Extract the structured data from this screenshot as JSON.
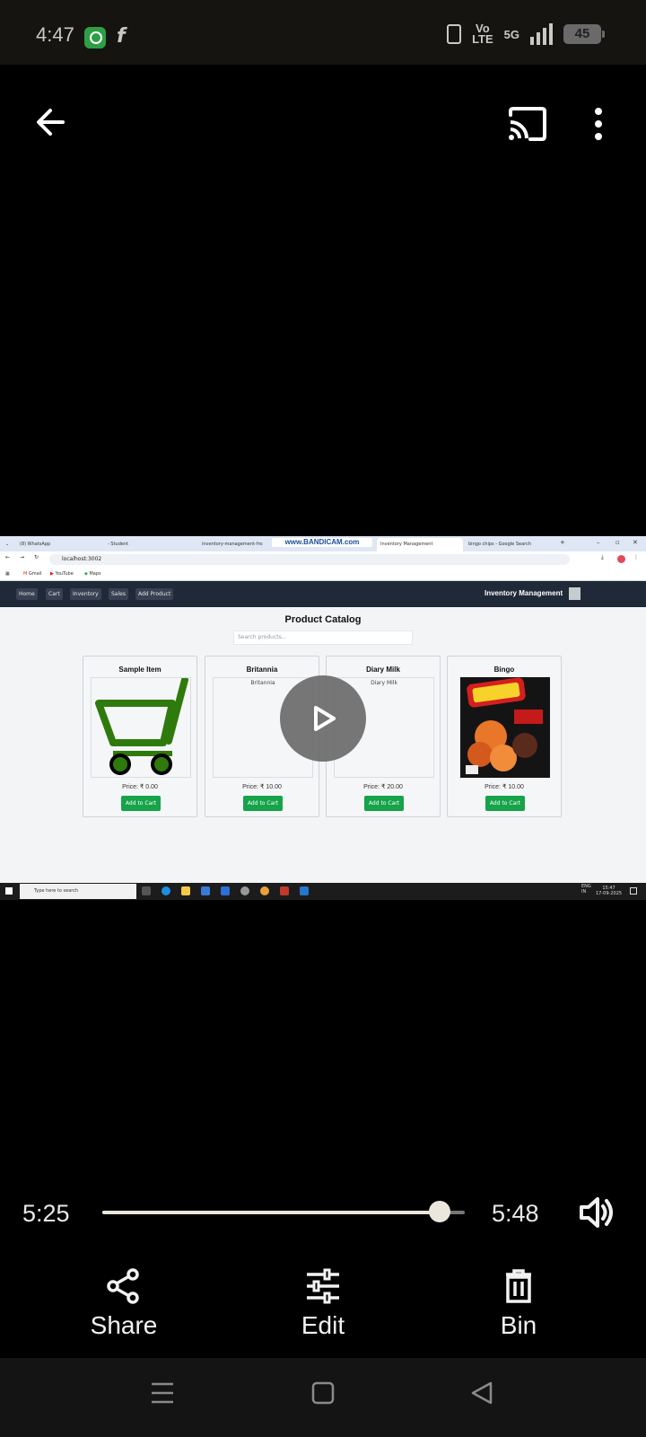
{
  "status_bar": {
    "time": "4:47",
    "network_label": "Vo\nLTE",
    "network_type": "5G",
    "battery": "45"
  },
  "browser": {
    "tabs": [
      "(8) WhatsApp",
      "- Student",
      "inventory-management-fro",
      "Inventory Management",
      "bingo chips - Google Search"
    ],
    "watermark": "www.BANDICAM.com",
    "url": "localhost:3002",
    "bookmarks": [
      "Gmail",
      "YouTube",
      "Maps"
    ]
  },
  "app": {
    "nav": [
      "Home",
      "Cart",
      "Inventory",
      "Sales",
      "Add Product"
    ],
    "title": "Inventory Management",
    "catalog_title": "Product Catalog",
    "search_placeholder": "Search products...",
    "add_to_cart": "Add to Cart",
    "products": [
      {
        "name": "Sample Item",
        "price": "Price: ₹ 0.00",
        "image": "cart-icon"
      },
      {
        "name": "Britannia",
        "price": "Price: ₹ 10.00",
        "image_alt": "Britannia"
      },
      {
        "name": "Diary Milk",
        "price": "Price: ₹ 20.00",
        "image_alt": "Diary Milk"
      },
      {
        "name": "Bingo",
        "price": "Price: ₹ 10.00",
        "image": "bingo-chips-pack"
      }
    ]
  },
  "taskbar": {
    "search_placeholder": "Type here to search",
    "lang": "ENG\nIN",
    "clock_time": "15:47",
    "clock_date": "17-09-2025"
  },
  "player": {
    "current_time": "5:25",
    "total_time": "5:48",
    "progress": 0.9313,
    "actions": [
      {
        "label": "Share",
        "icon": "share-icon"
      },
      {
        "label": "Edit",
        "icon": "sliders-icon"
      },
      {
        "label": "Bin",
        "icon": "trash-icon"
      }
    ]
  },
  "colors": {
    "accent_green": "#16a34a",
    "nav_dark": "#1f2937",
    "video_bg": "#000000"
  }
}
